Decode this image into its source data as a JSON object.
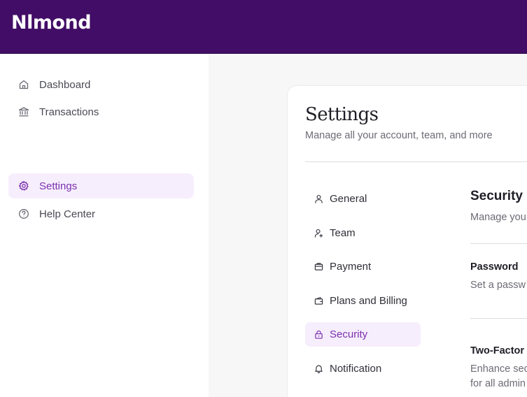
{
  "app": {
    "logo_text": "Nlmond",
    "brand_color": "#420d66",
    "accent_color": "#7b2fae"
  },
  "sidebar": {
    "items": [
      {
        "label": "Dashboard",
        "icon": "home-icon",
        "active": false
      },
      {
        "label": "Transactions",
        "icon": "bank-icon",
        "active": false
      },
      {
        "label": "Settings",
        "icon": "gear-icon",
        "active": true
      },
      {
        "label": "Help Center",
        "icon": "help-circle-icon",
        "active": false
      }
    ]
  },
  "settings": {
    "title": "Settings",
    "subtitle": "Manage all your account, team, and more",
    "nav": [
      {
        "label": "General",
        "icon": "user-icon",
        "active": false
      },
      {
        "label": "Team",
        "icon": "user-plus-icon",
        "active": false
      },
      {
        "label": "Payment",
        "icon": "card-icon",
        "active": false
      },
      {
        "label": "Plans and Billing",
        "icon": "wallet-icon",
        "active": false
      },
      {
        "label": "Security",
        "icon": "lock-icon",
        "active": true
      },
      {
        "label": "Notification",
        "icon": "bell-icon",
        "active": false
      }
    ]
  },
  "security": {
    "title": "Security",
    "subtitle": "Manage you",
    "password": {
      "title": "Password",
      "desc": "Set a passw"
    },
    "two_factor": {
      "title": "Two-Factor",
      "desc_line1": "Enhance sec",
      "desc_line2": "for all admin"
    }
  }
}
